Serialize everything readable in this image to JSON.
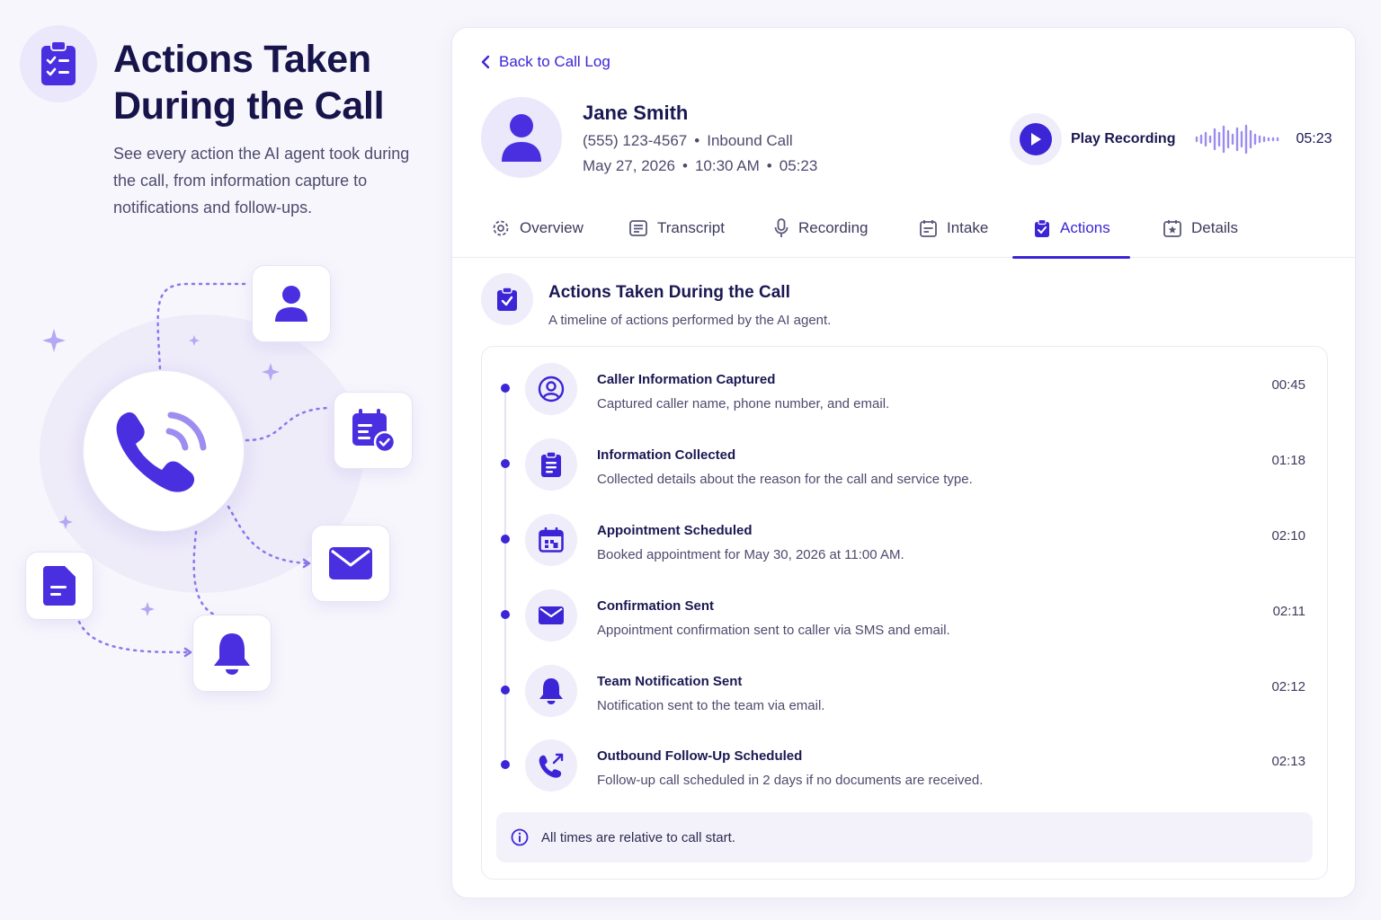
{
  "hero": {
    "title": "Actions Taken During the Call",
    "subtitle": "See every action the AI agent took during the call, from information capture to notifications and follow-ups."
  },
  "nav": {
    "back_label": "Back to Call Log"
  },
  "caller": {
    "name": "Jane Smith",
    "phone": "(555) 123-4567",
    "call_type": "Inbound Call",
    "date": "May 27, 2026",
    "time": "10:30 AM",
    "duration": "05:23"
  },
  "recording": {
    "label": "Play Recording",
    "duration": "05:23"
  },
  "tabs": [
    {
      "label": "Overview",
      "icon": "overview-icon"
    },
    {
      "label": "Transcript",
      "icon": "transcript-icon"
    },
    {
      "label": "Recording",
      "icon": "microphone-icon"
    },
    {
      "label": "Intake",
      "icon": "intake-icon"
    },
    {
      "label": "Actions",
      "icon": "clipboard-check-icon",
      "active": true
    },
    {
      "label": "Details",
      "icon": "details-icon"
    }
  ],
  "section": {
    "title": "Actions Taken During the Call",
    "subtitle": "A timeline of actions performed by the AI agent."
  },
  "actions": [
    {
      "title": "Caller Information Captured",
      "desc": "Captured caller name, phone number, and email.",
      "time": "00:45",
      "icon": "user-circle-icon"
    },
    {
      "title": "Information Collected",
      "desc": "Collected details about the reason for the call and service type.",
      "time": "01:18",
      "icon": "clipboard-list-icon"
    },
    {
      "title": "Appointment Scheduled",
      "desc": "Booked appointment for May 30, 2026 at 11:00 AM.",
      "time": "02:10",
      "icon": "calendar-icon"
    },
    {
      "title": "Confirmation Sent",
      "desc": "Appointment confirmation sent to caller via SMS and email.",
      "time": "02:11",
      "icon": "envelope-icon"
    },
    {
      "title": "Team Notification Sent",
      "desc": "Notification sent to the team via email.",
      "time": "02:12",
      "icon": "bell-icon"
    },
    {
      "title": "Outbound Follow-Up Scheduled",
      "desc": "Follow-up call scheduled in 2 days if no documents are received.",
      "time": "02:13",
      "icon": "phone-outgoing-icon"
    }
  ],
  "footnote": "All times are relative to call start.",
  "colors": {
    "accent": "#3b25d6",
    "accent_soft": "#efedfa",
    "text_dark": "#1a1852",
    "text_muted": "#4d4b6d"
  }
}
